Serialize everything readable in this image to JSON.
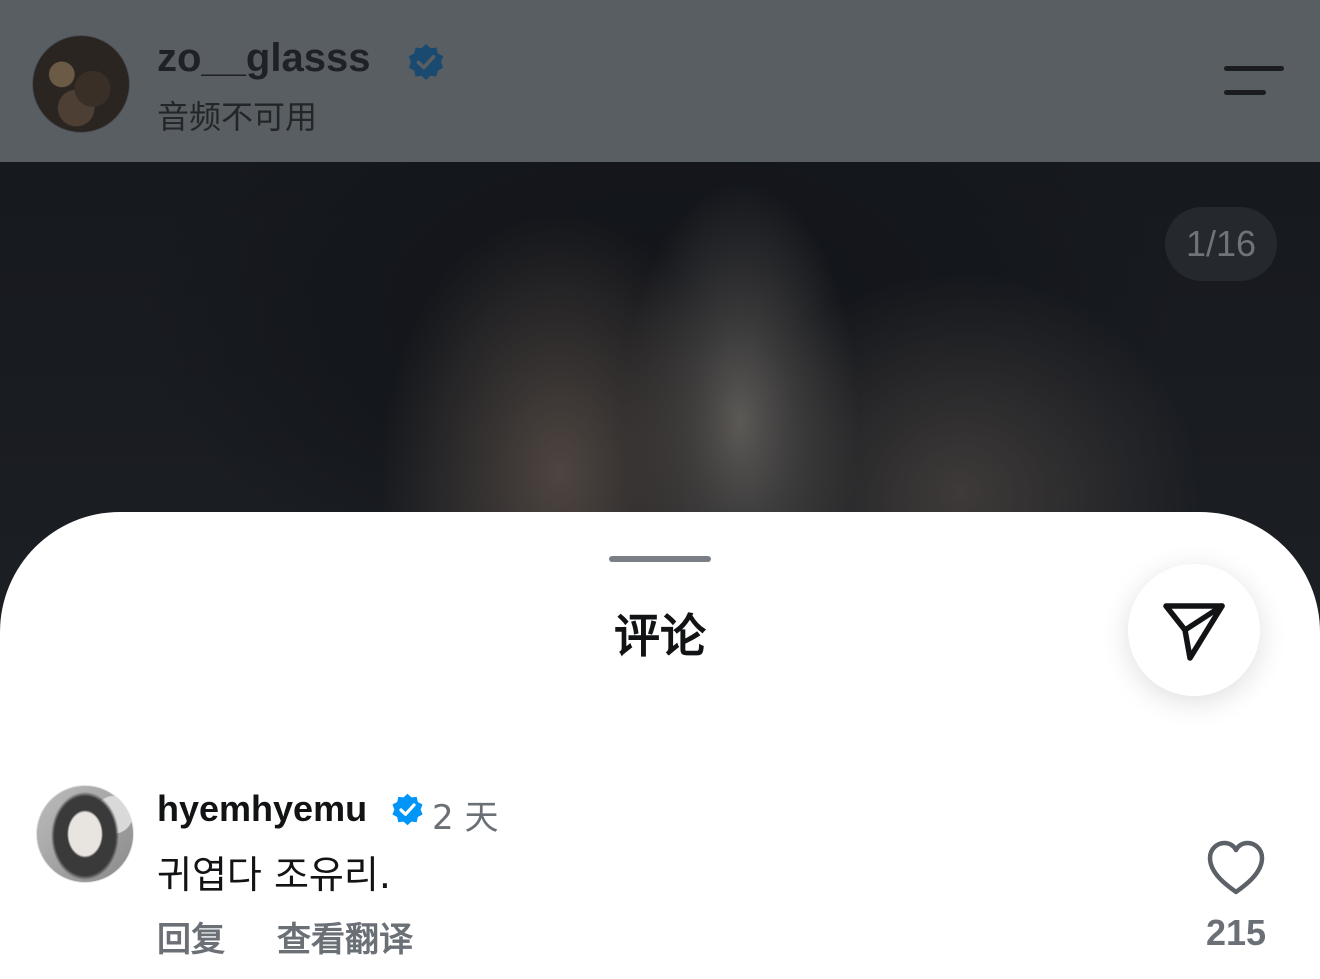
{
  "post": {
    "username": "zo__glasss",
    "verified": true,
    "audio_status": "音频不可用",
    "page_counter": "1/16",
    "menu_icon": "menu-icon",
    "verified_icon": "verified-badge-icon"
  },
  "comments_sheet": {
    "title": "评论",
    "share_icon": "send-icon"
  },
  "comments": [
    {
      "username": "hyemhyemu",
      "verified": true,
      "time": "2 天",
      "text": "귀엽다 조유리.",
      "reply_label": "回复",
      "translate_label": "查看翻译",
      "like_count": "215",
      "like_icon": "heart-icon"
    }
  ],
  "colors": {
    "verified_blue": "#0095f6",
    "secondary_text": "#6b7077",
    "primary_text": "#111315",
    "dim_overlay_header": "#595e63"
  }
}
